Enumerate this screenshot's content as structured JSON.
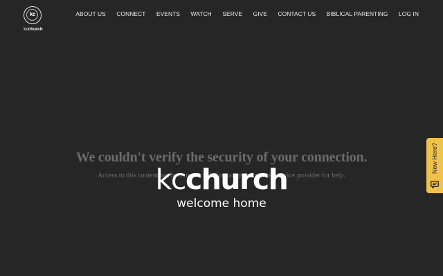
{
  "header": {
    "logo": {
      "mark": "kc",
      "word_light": "kc",
      "word_bold": "church"
    },
    "nav": [
      {
        "label": "ABOUT US"
      },
      {
        "label": "CONNECT"
      },
      {
        "label": "EVENTS"
      },
      {
        "label": "WATCH"
      },
      {
        "label": "SERVE"
      },
      {
        "label": "GIVE"
      },
      {
        "label": "CONTACT US"
      },
      {
        "label": "BIBLICAL PARENTING"
      },
      {
        "label": "LOG IN"
      }
    ]
  },
  "error": {
    "title": "We couldn't verify the security of your connection.",
    "body": "Access to this content has been restricted. Contact your internet service provider for help."
  },
  "hero": {
    "brand_light": "kc",
    "brand_bold": "church",
    "tagline": "welcome home"
  },
  "side_tab": {
    "label": "New Here?",
    "icon": "chat-icon",
    "color": "#f0c24b"
  },
  "colors": {
    "background": "#262626",
    "text": "#ffffff"
  }
}
